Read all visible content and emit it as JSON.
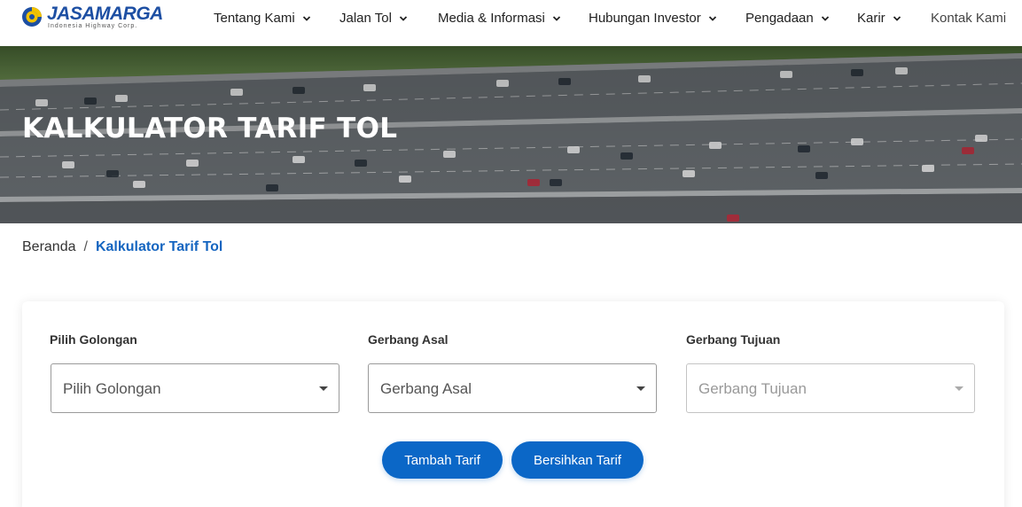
{
  "brand": {
    "name": "JASAMARGA",
    "tagline": "Indonesia Highway Corp."
  },
  "nav": {
    "items": [
      {
        "label": "Tentang Kami"
      },
      {
        "label": "Jalan Tol"
      },
      {
        "label": "Media & Informasi"
      },
      {
        "label": "Hubungan Investor"
      },
      {
        "label": "Pengadaan"
      },
      {
        "label": "Karir"
      }
    ],
    "contact": "Kontak Kami"
  },
  "hero": {
    "title": "KALKULATOR TARIF TOL"
  },
  "breadcrumb": {
    "home": "Beranda",
    "separator": "/",
    "current": "Kalkulator Tarif Tol"
  },
  "form": {
    "golongan": {
      "label": "Pilih Golongan",
      "value": "Pilih Golongan"
    },
    "asal": {
      "label": "Gerbang Asal",
      "value": "Gerbang Asal"
    },
    "tujuan": {
      "label": "Gerbang Tujuan",
      "value": "Gerbang Tujuan",
      "disabled": true
    },
    "add_button": "Tambah Tarif",
    "clear_button": "Bersihkan Tarif"
  },
  "colors": {
    "accent": "#0b67c7",
    "brand": "#1d4fa3",
    "breadcrumb_active": "#1565c0"
  },
  "icons": {
    "nav_dropdown": "chevron-down-icon",
    "select_dropdown": "caret-down-icon"
  }
}
